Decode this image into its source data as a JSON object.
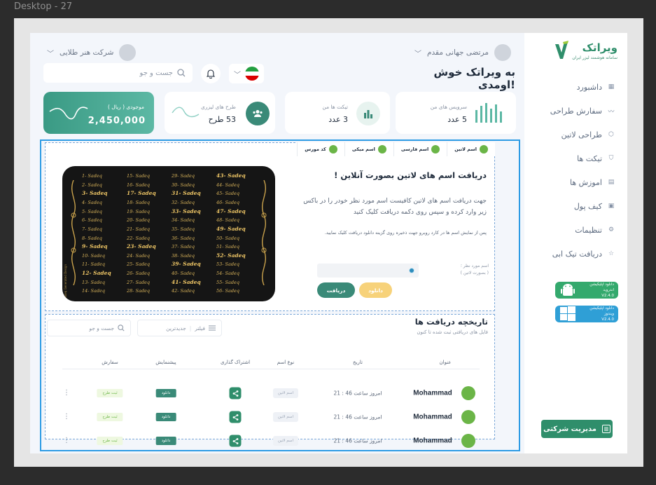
{
  "frame_label": "Desktop - 27",
  "brand": {
    "name": "ویراتک",
    "tagline": "سامانه هوشمند لیزر ایران",
    "color": "#2f8e6b"
  },
  "header": {
    "user_name": "مرتضی جهانی مقدم",
    "company": "شرکت هنر طلایی",
    "welcome": "به ویراتک خوش اومدی!",
    "search_placeholder": "جست و جو"
  },
  "sidebar": {
    "items": [
      {
        "label": "داشبورد",
        "icon": "grid-icon"
      },
      {
        "label": "سفارش طراحی",
        "icon": "trend-icon"
      },
      {
        "label": "طراحی لاتین",
        "icon": "cube-icon"
      },
      {
        "label": "تیکت ها",
        "icon": "shield-icon"
      },
      {
        "label": "اموزش ها",
        "icon": "calendar-icon"
      },
      {
        "label": "کیف پول",
        "icon": "wallet-icon"
      },
      {
        "label": "تنظیمات",
        "icon": "gear-icon"
      },
      {
        "label": "دریافت تیک ابی",
        "icon": "star-icon"
      }
    ],
    "android_app": {
      "line1": "دانلود اپلیکیشن اندروید",
      "version": "V2.4.0"
    },
    "windows_app": {
      "line1": "دانلود اپلیکیشن ویندوز",
      "version": "V2.4.0"
    },
    "corp_button": "مدیریت شرکتی"
  },
  "cards": {
    "services": {
      "label": "سرویس های من",
      "value": "5 عدد"
    },
    "tickets": {
      "label": "تیکت ها من",
      "value": "3 عدد"
    },
    "laser": {
      "label": "طرح های لیزری",
      "value": "53 طرح"
    },
    "balance": {
      "label": "موجودی ( ریال )",
      "value": "2,450,000"
    }
  },
  "latin": {
    "tabs": [
      "اسم لاتین",
      "اسم فارسی",
      "اسم میکی",
      "کد مورس"
    ],
    "title": "دریافت اسم های لاتین بصورت آنلاین !",
    "desc": "جهت دریافت اسم های لاتین کافیست اسم مورد نظر خودر را در باکس زیر وارد کرده و سپس روی دکمه دریافت کلیک کنید",
    "note": "پس از نمایش اسم ها در کارد روبرو جهت ذخیره روی گزینه دانلود دریافت کلیک نمایید.",
    "input_label_1": "اسم مورد نظر ؛",
    "input_label_2": "( بصورت لاتین )",
    "download_label": "دانلود",
    "get_label": "دریافت",
    "sample_name": "Sadeq",
    "sample_watermark": "Sadeq Generated Design",
    "sample_numbers": [
      1,
      2,
      3,
      4,
      5,
      6,
      7,
      8,
      9,
      10,
      11,
      12,
      13,
      14,
      15,
      16,
      17,
      18,
      19,
      20,
      21,
      22,
      23,
      24,
      25,
      26,
      27,
      28,
      29,
      30,
      31,
      32,
      33,
      34,
      35,
      36,
      37,
      38,
      39,
      40,
      41,
      42,
      43,
      44,
      45,
      46,
      47,
      48,
      49,
      50,
      51,
      52,
      53,
      54,
      55,
      56
    ]
  },
  "history": {
    "title": "تاریخچه دریافت ها",
    "subtitle": "فایل های دریافتی ثبت شده تا کنون",
    "filter_label": "فیلتر",
    "sort_label": "جدیدترین",
    "search_placeholder": "جست و جو",
    "columns": [
      "عنوان",
      "تاریخ",
      "نوع اسم",
      "اشتراک گذاری",
      "پیشنمایش",
      "سفارش"
    ],
    "rows": [
      {
        "title": "Mohammad",
        "date": "امروز ساعت 46 : 21",
        "type": "اسم لاتین",
        "preview": "دانلود",
        "order": "ثبت طرح"
      },
      {
        "title": "Mohammad",
        "date": "امروز ساعت 46 : 21",
        "type": "اسم لاتین",
        "preview": "دانلود",
        "order": "ثبت طرح"
      },
      {
        "title": "Mohammad",
        "date": "امروز ساعت 46 : 21",
        "type": "اسم لاتین",
        "preview": "دانلود",
        "order": "ثبت طرح"
      }
    ]
  },
  "colors": {
    "accent": "#2f8e6b",
    "selection": "#2d9be4",
    "leaf": "#6bb547",
    "yellow": "#f7d27a"
  }
}
